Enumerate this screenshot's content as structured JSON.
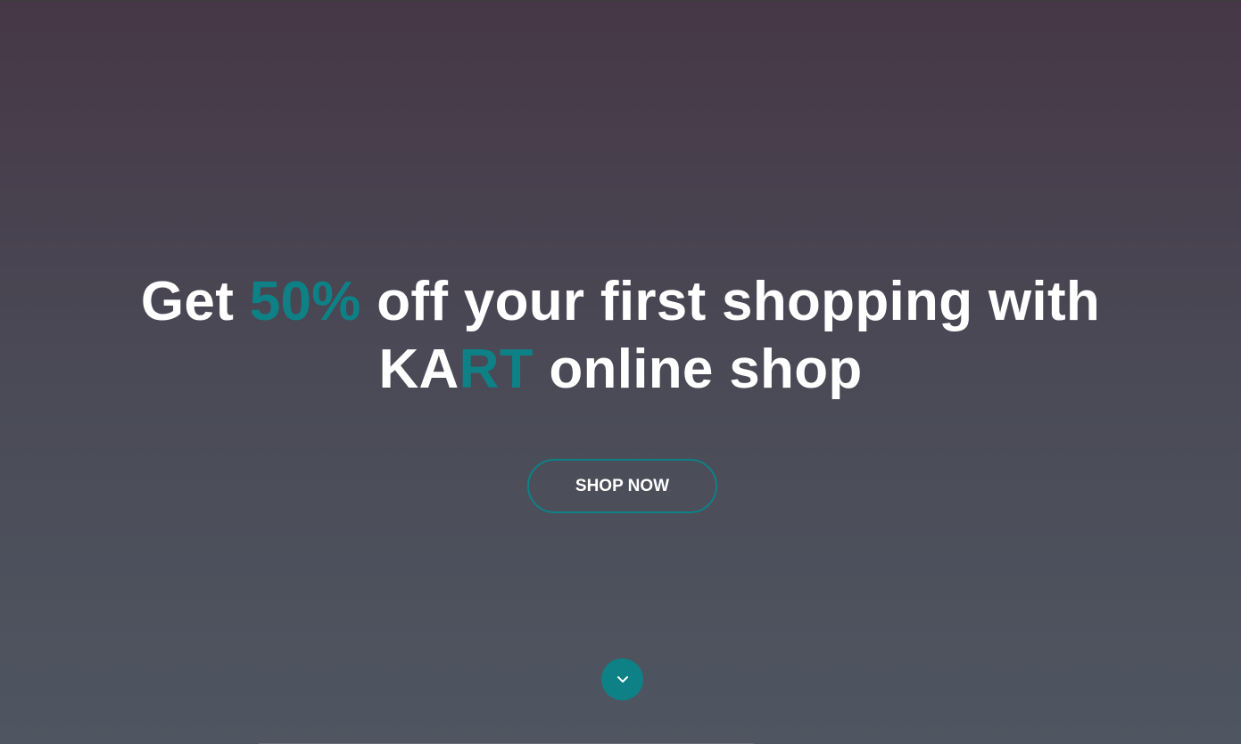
{
  "hero": {
    "headline": {
      "line1_before": "Get ",
      "line1_accent": "50%",
      "line1_after": " off your first shopping with",
      "line2_brand_plain": "KA",
      "line2_brand_accent": "RT",
      "line2_after": " online shop"
    },
    "cta_label": "SHOP NOW",
    "scroll_icon": "chevron-down-icon"
  },
  "colors": {
    "accent": "#0e8186",
    "text": "#ffffff",
    "background_top": "#463746",
    "background_bottom": "#4f5661"
  }
}
